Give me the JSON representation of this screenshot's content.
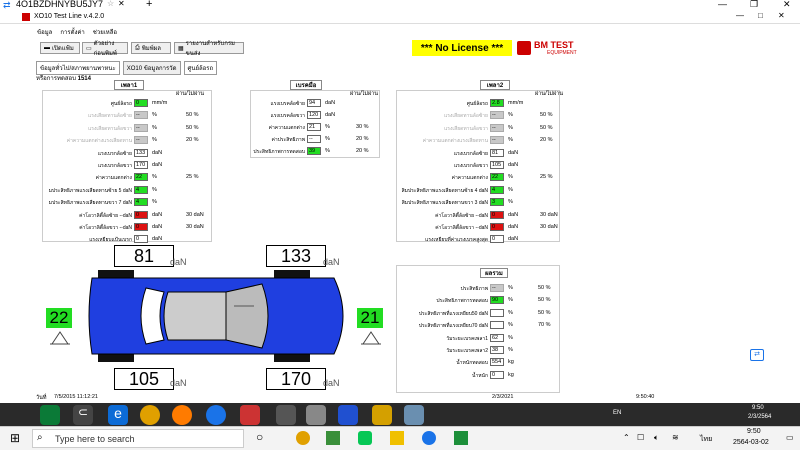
{
  "teamviewer": {
    "session_id": "4O1BZDHNYBU5JY7",
    "add_tab": "+"
  },
  "app": {
    "title": "XO10 Test Line v.4.2.0"
  },
  "menu": [
    "ข้อมูล",
    "การตั้งค่า",
    "ช่วยเหลือ"
  ],
  "toolbar": {
    "btn1": "เปิดแฟ้ม",
    "btn2": "ตัวอย่างก่อนพิมพ์",
    "btn3": "พิมพ์ผล",
    "btn4": "รายงานสำหรับกรมขนส่ง"
  },
  "license": "*** No License ***",
  "brand": {
    "logo": "BM TEST",
    "sub": "EQUIPMENT"
  },
  "tabs": [
    "ข้อมูลทั่วไป/สภาพยานพาหนะ",
    "XO10 ข้อมูลการวัด",
    "ศูนย์ล้อรถ"
  ],
  "vehicle": {
    "label": "หรือการทดสอบ",
    "value": "1514"
  },
  "axle1": {
    "header": "เพลา1",
    "pass_header": "ผ่าน/ไม่ผ่าน",
    "rows": [
      {
        "label": "ศูนย์ล้อรถ",
        "value": "0",
        "unit": "mm/m",
        "cls": "green",
        "dim": false,
        "side": ""
      },
      {
        "label": "แรงเสียดทานล้อซ้าย",
        "value": "--",
        "unit": "%",
        "cls": "grayb",
        "dim": true,
        "side": "50 %"
      },
      {
        "label": "แรงเสียดทานล้อขวา",
        "value": "--",
        "unit": "%",
        "cls": "grayb",
        "dim": true,
        "side": "50 %"
      },
      {
        "label": "ค่าความแตกต่างแรงเสียดทาน",
        "value": "--",
        "unit": "%",
        "cls": "grayb",
        "dim": true,
        "side": "20 %"
      },
      {
        "label": "แรงเบรกล้อซ้าย",
        "value": "133",
        "unit": "daN",
        "cls": "",
        "dim": false,
        "side": ""
      },
      {
        "label": "แรงเบรกล้อขวา",
        "value": "170",
        "unit": "daN",
        "cls": "",
        "dim": false,
        "side": ""
      },
      {
        "label": "ค่าความแตกต่าง",
        "value": "22",
        "unit": "%",
        "cls": "green",
        "dim": false,
        "side": "25 %"
      },
      {
        "label": "มประสิทธิภาพแรงเสียดทานซ้าย  5 daN",
        "value": "4",
        "unit": "%",
        "cls": "green",
        "dim": false,
        "side": ""
      },
      {
        "label": "มประสิทธิภาพแรงเสียดทานขวา  7 daN",
        "value": "4",
        "unit": "%",
        "cls": "green",
        "dim": false,
        "side": ""
      },
      {
        "label": "ค่าโอวาลิตี้ล้อซ้าย    --daN",
        "value": "0",
        "unit": "daN",
        "cls": "red",
        "dim": false,
        "side": "30 daN"
      },
      {
        "label": "ค่าโอวาลิตี้ล้อขวา    --daN",
        "value": "0",
        "unit": "daN",
        "cls": "red",
        "dim": false,
        "side": "30 daN"
      },
      {
        "label": "แรงเหยียบแป้นเบรก",
        "value": "0",
        "unit": "daN",
        "cls": "",
        "dim": false,
        "side": ""
      }
    ]
  },
  "parking": {
    "header": "เบรคมือ",
    "pass_header": "ผ่าน/ไม่ผ่าน",
    "rows": [
      {
        "label": "แรงเบรคล้อซ้าย",
        "value": "94",
        "unit": "daN",
        "cls": "",
        "side": ""
      },
      {
        "label": "แรงเบรคล้อขวา",
        "value": "120",
        "unit": "daN",
        "cls": "",
        "side": ""
      },
      {
        "label": "ค่าความแตกต่าง",
        "value": "21",
        "unit": "%",
        "cls": "",
        "side": "30 %"
      },
      {
        "label": "ค่าประสิทธิภาพ",
        "value": "--",
        "unit": "%",
        "cls": "",
        "side": "20 %"
      },
      {
        "label": "ประสิทธิภาพการทดสอบ",
        "value": "39",
        "unit": "%",
        "cls": "green",
        "side": "20 %"
      }
    ]
  },
  "axle2": {
    "header": "เพลา2",
    "pass_header": "ผ่าน/ไม่ผ่าน",
    "rows": [
      {
        "label": "ศูนย์ล้อรถ",
        "value": "2.8",
        "unit": "mm/m",
        "cls": "green",
        "dim": false,
        "side": ""
      },
      {
        "label": "แรงเสียดทานล้อซ้าย",
        "value": "--",
        "unit": "%",
        "cls": "grayb",
        "dim": true,
        "side": "50 %"
      },
      {
        "label": "แรงเสียดทานล้อขวา",
        "value": "--",
        "unit": "%",
        "cls": "grayb",
        "dim": true,
        "side": "50 %"
      },
      {
        "label": "ค่าความแตกต่างแรงเสียดทาน",
        "value": "--",
        "unit": "%",
        "cls": "grayb",
        "dim": true,
        "side": "20 %"
      },
      {
        "label": "แรงเบรกล้อซ้าย",
        "value": "81",
        "unit": "daN",
        "cls": "",
        "dim": false,
        "side": ""
      },
      {
        "label": "แรงเบรกล้อขวา",
        "value": "105",
        "unit": "daN",
        "cls": "",
        "dim": false,
        "side": ""
      },
      {
        "label": "ค่าความแตกต่าง",
        "value": "22",
        "unit": "%",
        "cls": "green",
        "dim": false,
        "side": "25 %"
      },
      {
        "label": "สิมประสิทธิภาพแรงเสียดทานซ้าย  4 daN",
        "value": "4",
        "unit": "%",
        "cls": "green",
        "dim": false,
        "side": ""
      },
      {
        "label": "สิมประสิทธิภาพแรงเสียดทานขวา  3 daN",
        "value": "3",
        "unit": "%",
        "cls": "green",
        "dim": false,
        "side": ""
      },
      {
        "label": "ค่าโอวาลิตี้ล้อซ้าย    --daN",
        "value": "0",
        "unit": "daN",
        "cls": "red",
        "dim": false,
        "side": "30 daN"
      },
      {
        "label": "ค่าโอวาลิตี้ล้อขวา    --daN",
        "value": "0",
        "unit": "daN",
        "cls": "red",
        "dim": false,
        "side": "30 daN"
      },
      {
        "label": "แรงเหยียบที่ค่าแรงเบรคสูงสุด",
        "value": "0",
        "unit": "daN",
        "cls": "",
        "dim": false,
        "side": ""
      }
    ]
  },
  "summary": {
    "header": "ผลรวม",
    "rows": [
      {
        "label": "ประสิทธิภาพ",
        "value": "--",
        "unit": "%",
        "cls": "grayb",
        "side": "50 %"
      },
      {
        "label": "ประสิทธิภาพการทดสอบ",
        "value": "90",
        "unit": "%",
        "cls": "green",
        "side": "50 %"
      },
      {
        "label": "ประสิทธิภาพที่แรงเหยียบ50 daN",
        "value": "",
        "unit": "%",
        "cls": "",
        "side": "50 %"
      },
      {
        "label": "ประสิทธิภาพที่แรงเหยียบ70 daN",
        "value": "",
        "unit": "%",
        "cls": "",
        "side": "70 %"
      },
      {
        "label": "วัมระยะเบรคเพลา1",
        "value": "62",
        "unit": "%",
        "cls": "",
        "side": ""
      },
      {
        "label": "วัมระยะเบรคเพลา2",
        "value": "38",
        "unit": "%",
        "cls": "",
        "side": ""
      },
      {
        "label": "น้ำหนักทดสอบ",
        "value": "554",
        "unit": "kg",
        "cls": "",
        "side": ""
      },
      {
        "label": "น้ำหนัก",
        "value": "0",
        "unit": "kg",
        "cls": "",
        "side": ""
      }
    ]
  },
  "car": {
    "fl": "81",
    "fr": "133",
    "rl": "105",
    "rr": "170",
    "unit": "daN",
    "left_weight": "22",
    "right_weight": "21"
  },
  "status": {
    "date_label": "วันที่",
    "datetime": "7/5/2015 11:12:21",
    "date2": "2/3/2021",
    "time2": "9:50:40"
  },
  "taskbar": {
    "search": "Type here to search",
    "time": "9:50",
    "date": "2564-03-02",
    "lang": "ไทย",
    "inner_time": "9:50",
    "inner_date": "2/3/2564",
    "inner_lang": "EN"
  }
}
